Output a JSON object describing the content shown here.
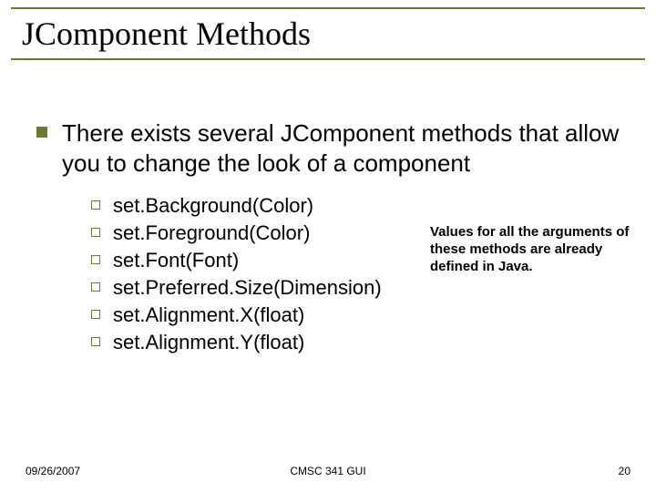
{
  "title": "JComponent Methods",
  "body": {
    "intro": "There exists several JComponent methods that allow you to change the look of a component",
    "methods": [
      "set.Background(Color)",
      "set.Foreground(Color)",
      "set.Font(Font)",
      "set.Preferred.Size(Dimension)",
      "set.Alignment.X(float)",
      "set.Alignment.Y(float)"
    ]
  },
  "sidenote": "Values for all the arguments of these methods are already defined in Java.",
  "footer": {
    "date": "09/26/2007",
    "center": "CMSC 341 GUI",
    "page": "20"
  }
}
